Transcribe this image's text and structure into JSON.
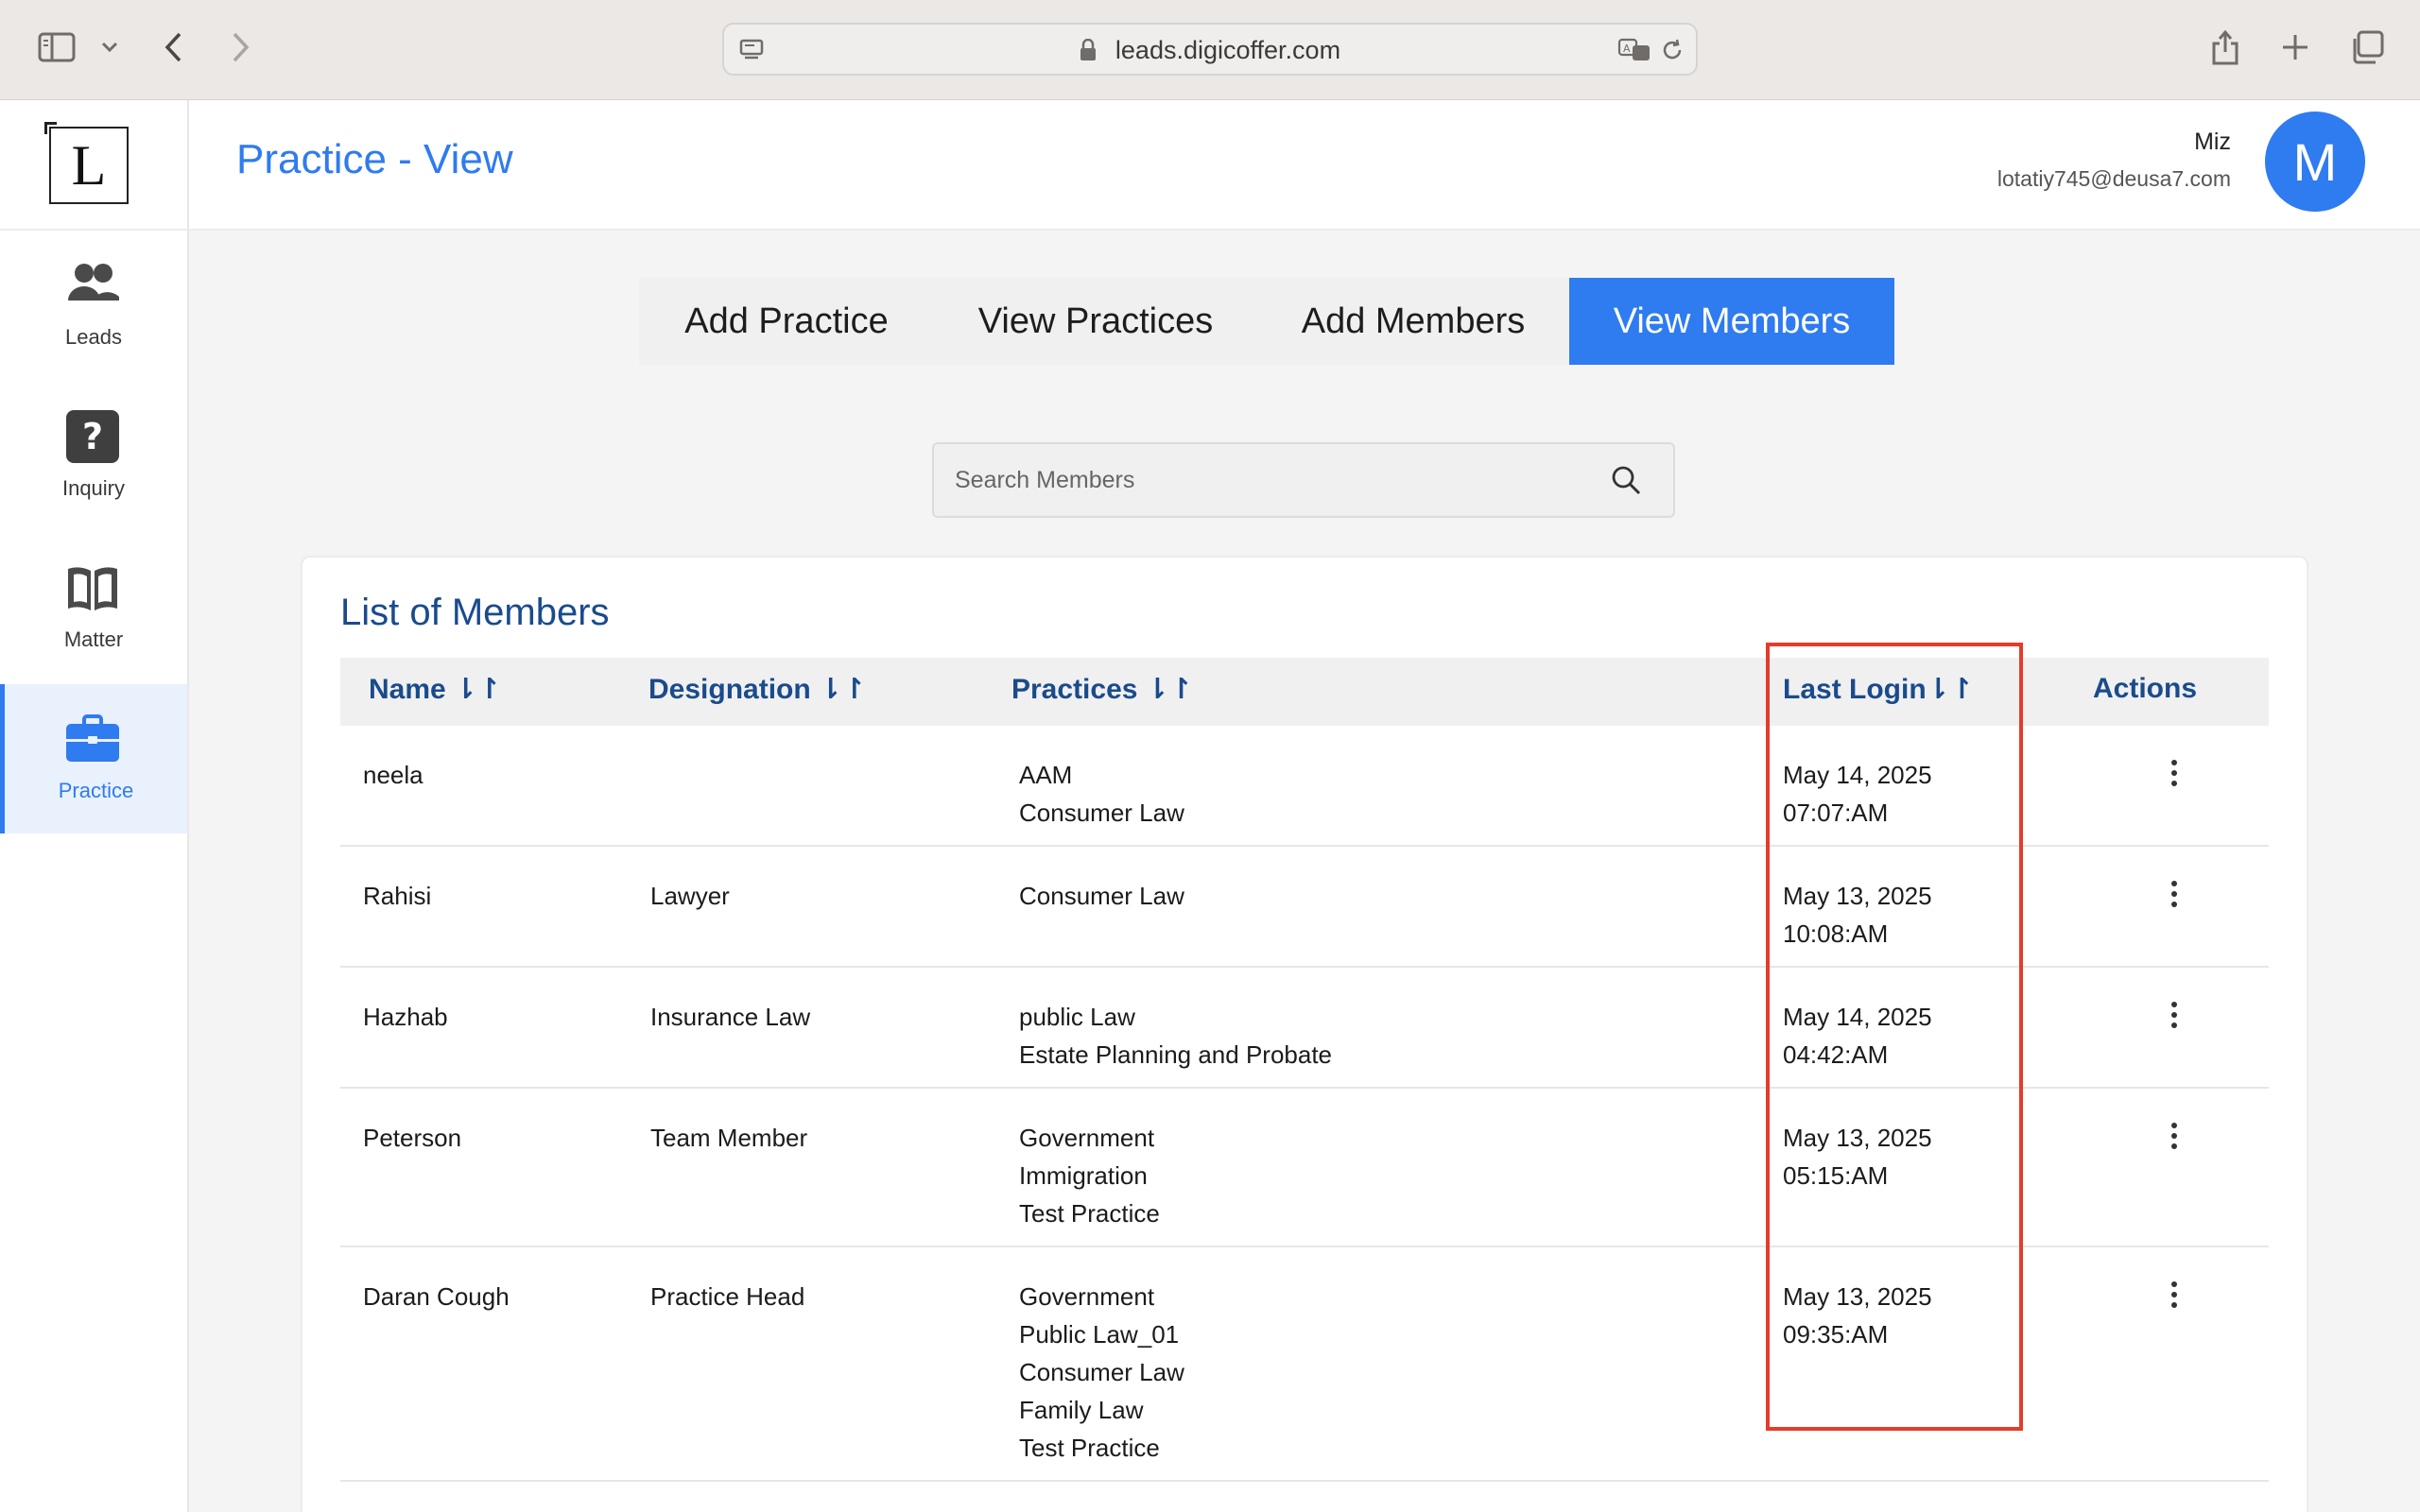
{
  "browser": {
    "url": "leads.digicoffer.com"
  },
  "sidebar": {
    "logo_letter": "L",
    "items": [
      {
        "label": "Leads",
        "icon": "users-icon"
      },
      {
        "label": "Inquiry",
        "icon": "question-icon"
      },
      {
        "label": "Matter",
        "icon": "book-icon"
      },
      {
        "label": "Practice",
        "icon": "briefcase-icon",
        "active": true
      }
    ]
  },
  "header": {
    "title": "Practice - View",
    "user_name": "Miz",
    "user_email": "lotatiy745@deusa7.com",
    "avatar_letter": "M"
  },
  "tabs": [
    {
      "label": "Add Practice"
    },
    {
      "label": "View Practices"
    },
    {
      "label": "Add Members"
    },
    {
      "label": "View Members",
      "active": true
    }
  ],
  "search": {
    "placeholder": "Search Members",
    "value": ""
  },
  "members": {
    "title": "List of Members",
    "columns": {
      "name": "Name ⇂↾",
      "designation": "Designation ⇂↾",
      "practices": "Practices ⇂↾",
      "last_login": "Last Login⇂↾",
      "actions": "Actions"
    },
    "rows": [
      {
        "name": "neela",
        "designation": "",
        "practices": [
          "AAM",
          "Consumer Law"
        ],
        "login_date": "May 14, 2025",
        "login_time": "07:07:AM"
      },
      {
        "name": "Rahisi",
        "designation": "Lawyer",
        "practices": [
          "Consumer Law"
        ],
        "login_date": "May 13, 2025",
        "login_time": "10:08:AM"
      },
      {
        "name": "Hazhab",
        "designation": "Insurance Law",
        "practices": [
          "public Law",
          "Estate Planning and Probate"
        ],
        "login_date": "May 14, 2025",
        "login_time": "04:42:AM"
      },
      {
        "name": "Peterson",
        "designation": "Team Member",
        "practices": [
          "Government",
          "Immigration",
          "Test Practice"
        ],
        "login_date": "May 13, 2025",
        "login_time": "05:15:AM"
      },
      {
        "name": "Daran Cough",
        "designation": "Practice Head",
        "practices": [
          "Government",
          "Public Law_01",
          "Consumer Law",
          "Family Law",
          "Test Practice"
        ],
        "login_date": "May 13, 2025",
        "login_time": "09:35:AM"
      }
    ]
  },
  "colors": {
    "accent": "#2f7bf0",
    "heading": "#1a4b8c",
    "highlight": "#e53b2c"
  }
}
